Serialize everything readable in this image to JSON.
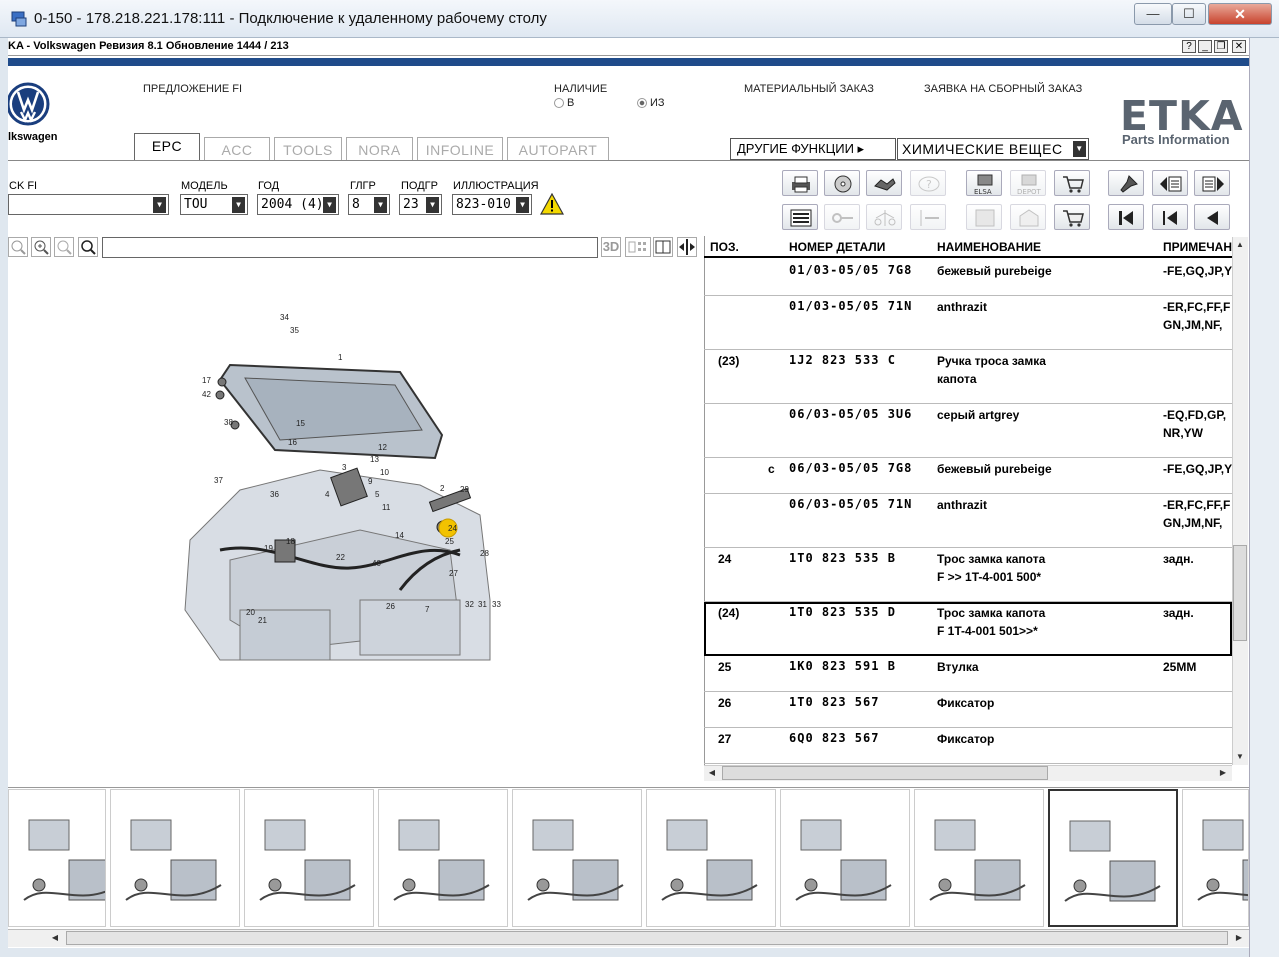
{
  "rdp": {
    "title": "0-150 - 178.218.221.178:111 - Подключение к удаленному рабочему столу",
    "min": "—",
    "max": "☐",
    "close": "✕"
  },
  "etka": {
    "title": "KA - Volkswagen Ревизия 8.1 Обновление 1444 / 213",
    "btn_help": "?",
    "btn_min": "_",
    "btn_restore": "❐",
    "btn_close": "✕"
  },
  "header": {
    "brand": "lkswagen",
    "offer": "ПРЕДЛОЖЕНИЕ FI",
    "availability": "НАЛИЧИЕ",
    "opt_in": "В",
    "opt_out": "ИЗ",
    "material_order": "МАТЕРИАЛЬНЫЙ ЗАКАЗ",
    "assembly_order": "ЗАЯВКА НА СБОРНЫЙ ЗАКАЗ",
    "logo": "ETKA",
    "logo_sub": "Parts Information"
  },
  "tabs": [
    "EPC",
    "ACC",
    "TOOLS",
    "NORA",
    "INFOLINE",
    "AUTOPART"
  ],
  "other_functions": "ДРУГИЕ ФУНКЦИИ ▸",
  "chem_select": "ХИМИЧЕСКИЕ ВЕЩЕС",
  "filters": {
    "mark_label": "CK FI",
    "model_label": "МОДЕЛЬ",
    "model_value": "TOU",
    "year_label": "ГОД",
    "year_value": "2004 (4)",
    "group_label": "ГЛГР",
    "group_value": "8",
    "subgroup_label": "ПОДГР",
    "subgroup_value": "23",
    "illus_label": "ИЛЛЮСТРАЦИЯ",
    "illus_value": "823-010"
  },
  "toolbar_icons": {
    "row1": [
      "print-icon",
      "cd-icon",
      "handshake-icon",
      "question-icon",
      "elsa-icon",
      "depot-icon",
      "cart-add-icon",
      "pin-icon",
      "prev-page-icon",
      "next-page-icon"
    ],
    "row1_labels": {
      "elsa": "ELSA",
      "depot": "DEPOT"
    },
    "row2": [
      "list-icon",
      "key-icon",
      "scale-icon",
      "dash-icon",
      "cabinet-icon",
      "shop-icon",
      "cart-icon",
      "first-icon",
      "prev-icon",
      "back-icon"
    ]
  },
  "image_toolbar": {
    "btn_3d": "3D"
  },
  "table": {
    "headers": {
      "pos": "ПОЗ.",
      "part": "НОМЕР ДЕТАЛИ",
      "name": "НАИМЕНОВАНИЕ",
      "note": "ПРИМЕЧАН"
    },
    "rows": [
      {
        "pos": "",
        "mark": "",
        "part": "01/03-05/05 7G8",
        "name": "бежевый purebeige",
        "name2": "",
        "note": "-FE,GQ,JP,Y",
        "note2": ""
      },
      {
        "pos": "",
        "mark": "",
        "part": "01/03-05/05 71N",
        "name": "anthrazit",
        "name2": "",
        "note": "-ER,FC,FF,F",
        "note2": " GN,JM,NF,"
      },
      {
        "pos": "(23)",
        "mark": "",
        "part": "1J2  823  533  C",
        "name": "Ручка троса замка",
        "name2": "капота",
        "note": "",
        "note2": ""
      },
      {
        "pos": "",
        "mark": "",
        "part": "06/03-05/05 3U6",
        "name": "серый artgrey",
        "name2": "",
        "note": "-EQ,FD,GP,",
        "note2": " NR,YW"
      },
      {
        "pos": "",
        "mark": "c",
        "part": "06/03-05/05 7G8",
        "name": "бежевый purebeige",
        "name2": "",
        "note": "-FE,GQ,JP,Y",
        "note2": ""
      },
      {
        "pos": "",
        "mark": "",
        "part": "06/03-05/05 71N",
        "name": "anthrazit",
        "name2": "",
        "note": "-ER,FC,FF,F",
        "note2": " GN,JM,NF,"
      },
      {
        "pos": "24",
        "mark": "",
        "part": "1T0  823  535  B",
        "name": "Трос замка капота",
        "name2": "F             >> 1T-4-001 500*",
        "note": "задн.",
        "note2": ""
      },
      {
        "pos": "(24)",
        "mark": "",
        "part": "1T0  823  535  D",
        "name": "Трос замка капота",
        "name2": "F 1T-4-001 501>>*",
        "note": "задн.",
        "note2": ""
      },
      {
        "pos": "25",
        "mark": "",
        "part": "1K0  823  591  B",
        "name": "Втулка",
        "name2": "",
        "note": "25ММ",
        "note2": ""
      },
      {
        "pos": "26",
        "mark": "",
        "part": "1T0  823  567",
        "name": "Фиксатор",
        "name2": "",
        "note": "",
        "note2": ""
      },
      {
        "pos": "27",
        "mark": "",
        "part": "6Q0  823  567",
        "name": "Фиксатор",
        "name2": "",
        "note": "",
        "note2": ""
      }
    ]
  },
  "diagram": {
    "callouts": [
      "34",
      "35",
      "1",
      "17",
      "42",
      "38",
      "15",
      "16",
      "12",
      "13",
      "2",
      "3",
      "4",
      "37",
      "36",
      "5",
      "9",
      "10",
      "11",
      "14",
      "24",
      "25",
      "29",
      "28",
      "18",
      "19",
      "22",
      "40",
      "26",
      "27",
      "7",
      "32",
      "31",
      "33",
      "20",
      "21"
    ],
    "highlight": "24"
  },
  "colors": {
    "accent_stripe": "#1f4b8a",
    "highlight": "#f2c200",
    "logo_gray": "#5a6470"
  }
}
